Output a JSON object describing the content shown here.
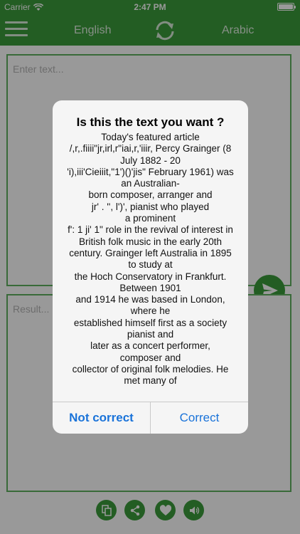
{
  "status": {
    "carrier": "Carrier",
    "time": "2:47 PM"
  },
  "nav": {
    "from_lang": "English",
    "to_lang": "Arabic"
  },
  "input": {
    "placeholder": "Enter text..."
  },
  "result": {
    "placeholder": "Result..."
  },
  "alert": {
    "title": "Is this the text you want ?",
    "lines": [
      "Today's featured article",
      "/,r,.fiiii\"jr,irl,r\"iai,r,'iiir, Percy Grainger (8",
      "July 1882 - 20",
      "'i),iii'Cieiiit,\"1')()'jis\" February 1961) was",
      "an Australian-",
      "born composer, arranger and",
      "jr' . '', l')', pianist who played",
      "a prominent",
      "f': 1 ji' 1\" role in the revival of interest in",
      "British folk music in the early 20th",
      "century. Grainger left Australia in 1895",
      "to study at",
      "the Hoch Conservatory in Frankfurt.",
      "Between 1901",
      "and 1914 he was based in London,",
      "where he",
      "established himself first as a society",
      "pianist and",
      "later as a concert performer,",
      "composer and",
      "collector of original folk melodies. He",
      "met many of"
    ],
    "not_correct_label": "Not correct",
    "correct_label": "Correct"
  },
  "bottom_icons": [
    "copy-icon",
    "share-icon",
    "heart-icon",
    "speaker-icon"
  ],
  "colors": {
    "brand_green": "#3b9b3b",
    "link_blue": "#1a73d9"
  }
}
